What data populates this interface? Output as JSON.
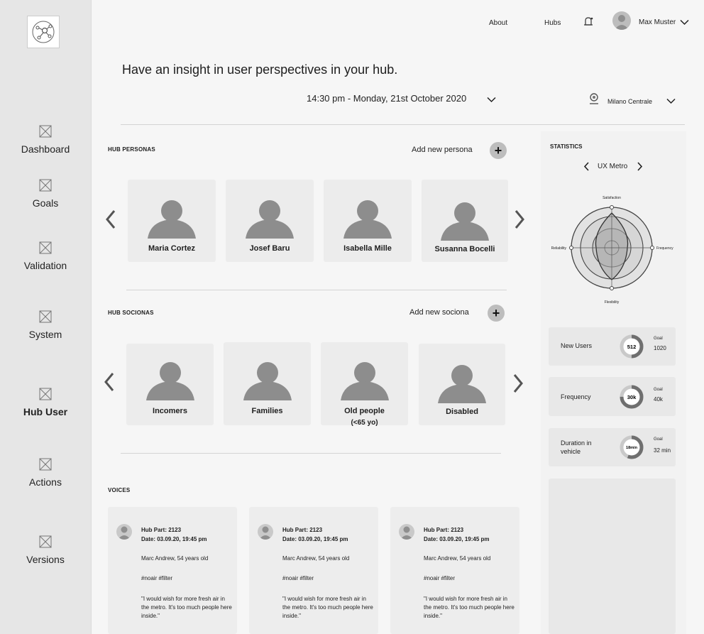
{
  "sidebar": {
    "logo_icon": "hub-network-icon",
    "items": [
      {
        "label": "Dashboard",
        "icon": "placeholder-x-icon",
        "active": false
      },
      {
        "label": "Goals",
        "icon": "placeholder-x-icon",
        "active": false
      },
      {
        "label": "Validation",
        "icon": "placeholder-x-icon",
        "active": false
      },
      {
        "label": "System",
        "icon": "placeholder-x-icon",
        "active": false
      },
      {
        "label": "Hub User",
        "icon": "placeholder-x-icon",
        "active": true
      },
      {
        "label": "Actions",
        "icon": "placeholder-x-icon",
        "active": false
      },
      {
        "label": "Versions",
        "icon": "placeholder-x-icon",
        "active": false
      }
    ]
  },
  "topbar": {
    "about": "About",
    "hubs": "Hubs",
    "bell_icon": "bell-icon",
    "user_name": "Max Muster"
  },
  "header": {
    "headline": "Have an insight in user perspectives in your hub.",
    "datetime": "14:30 pm -  Monday, 21st October 2020",
    "location": "Milano Centrale"
  },
  "personas": {
    "title": "HUB PERSONAS",
    "add_label": "Add new persona",
    "items": [
      {
        "name": "Maria Cortez"
      },
      {
        "name": "Josef Baru"
      },
      {
        "name": "Isabella Mille"
      },
      {
        "name": "Susanna Bocelli"
      }
    ]
  },
  "socionas": {
    "title": "HUB SOCIONAS",
    "add_label": "Add new sociona",
    "items": [
      {
        "name": "Incomers",
        "sub": ""
      },
      {
        "name": "Families",
        "sub": ""
      },
      {
        "name": "Old people",
        "sub": "(<65 yo)"
      },
      {
        "name": "Disabled",
        "sub": ""
      }
    ]
  },
  "statistics": {
    "title": "STATISTICS",
    "selector": "UX Metro",
    "radar_axes": {
      "top": "Satisfaction",
      "right": "Frequency",
      "bottom": "Flexibility",
      "left": "Reliability"
    },
    "cards": [
      {
        "label": "New Users",
        "value": "512",
        "goal_title": "Goal",
        "goal": "1020",
        "progress": 0.5
      },
      {
        "label": "Frequency",
        "value": "30k",
        "goal_title": "Goal",
        "goal": "40k",
        "progress": 0.75
      },
      {
        "label": "Duration in vehicle",
        "value": "18min",
        "goal_title": "Goal",
        "goal": "32 min",
        "progress": 0.56
      }
    ]
  },
  "voices": {
    "title": "VOICES",
    "items": [
      {
        "hub": "Hub Part: 2123",
        "date": "Date: 03.09.20, 19:45 pm",
        "author": "Marc Andrew, 54 years old",
        "tags": "#noair #filter",
        "quote": "\"I would wish for more fresh air in the metro. It's too much people here inside.\""
      },
      {
        "hub": "Hub Part: 2123",
        "date": "Date: 03.09.20, 19:45 pm",
        "author": "Marc Andrew, 54 years old",
        "tags": "#noair #filter",
        "quote": "\"I would wish for more fresh air in the metro. It's too much people here inside.\""
      },
      {
        "hub": "Hub Part: 2123",
        "date": "Date: 03.09.20, 19:45 pm",
        "author": "Marc Andrew, 54 years old",
        "tags": "#noair #filter",
        "quote": "\"I would wish for more fresh air in the metro. It's too much people here inside.\""
      }
    ]
  }
}
